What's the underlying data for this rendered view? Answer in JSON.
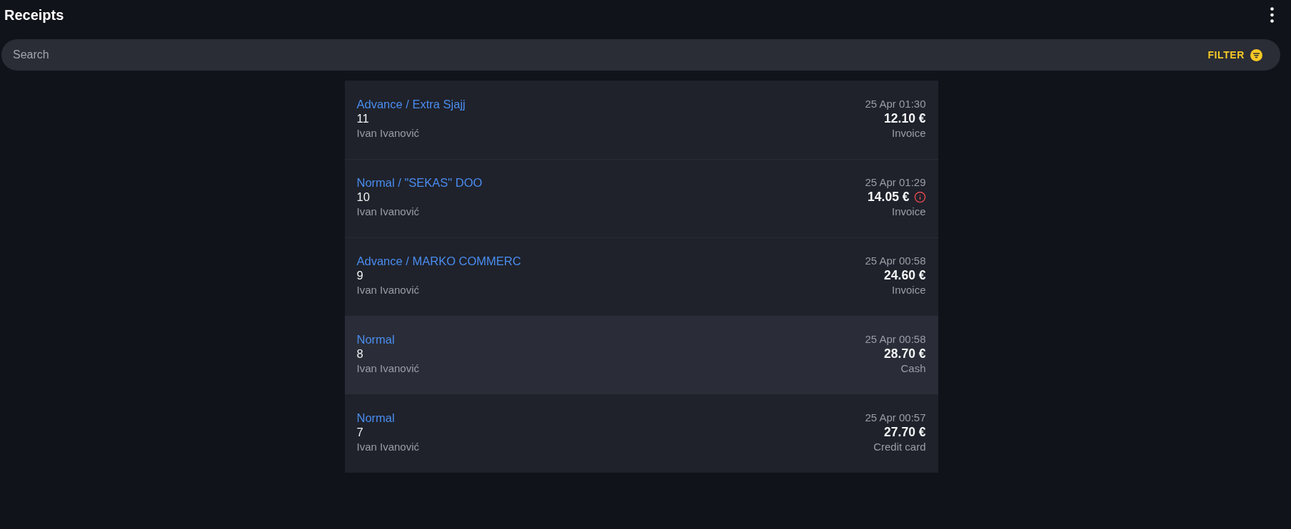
{
  "header": {
    "title": "Receipts"
  },
  "search": {
    "placeholder": "Search",
    "filter_label": "FILTER"
  },
  "receipts": [
    {
      "type": "Advance / Extra Sjajj",
      "number": "11",
      "cashier": "Ivan Ivanović",
      "date": "25 Apr 01:30",
      "amount": "12.10 €",
      "payment": "Invoice",
      "warning": false,
      "selected": false
    },
    {
      "type": "Normal / \"SEKAS\" DOO",
      "number": "10",
      "cashier": "Ivan Ivanović",
      "date": "25 Apr 01:29",
      "amount": "14.05 €",
      "payment": "Invoice",
      "warning": true,
      "selected": false
    },
    {
      "type": "Advance / MARKO COMMERC",
      "number": "9",
      "cashier": "Ivan Ivanović",
      "date": "25 Apr 00:58",
      "amount": "24.60 €",
      "payment": "Invoice",
      "warning": false,
      "selected": false
    },
    {
      "type": "Normal",
      "number": "8",
      "cashier": "Ivan Ivanović",
      "date": "25 Apr 00:58",
      "amount": "28.70 €",
      "payment": "Cash",
      "warning": false,
      "selected": true
    },
    {
      "type": "Normal",
      "number": "7",
      "cashier": "Ivan Ivanović",
      "date": "25 Apr 00:57",
      "amount": "27.70 €",
      "payment": "Credit card",
      "warning": false,
      "selected": false
    }
  ]
}
